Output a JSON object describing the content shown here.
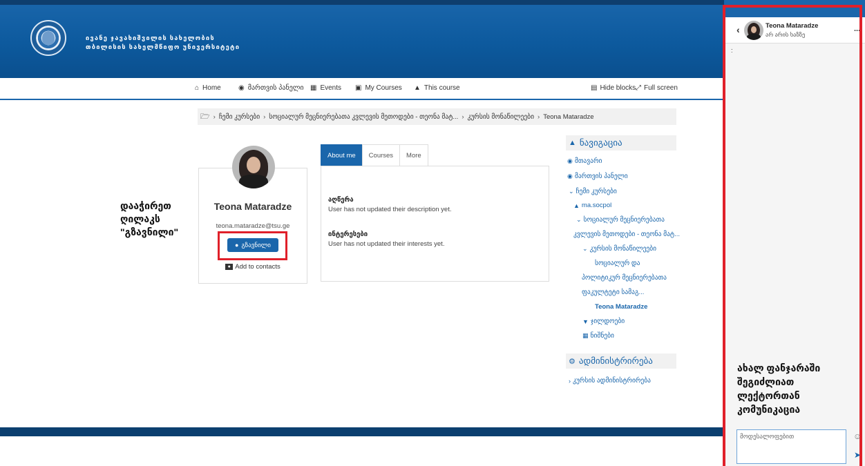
{
  "header": {
    "university_line1": "ივანე ჯავახიშვილის სახელობის",
    "university_line2": "თბილისის სახელმწიფო უნივერსიტეტი"
  },
  "nav": {
    "home": "Home",
    "dashboard": "მართვის პანელი",
    "events": "Events",
    "my_courses": "My Courses",
    "this_course": "This course",
    "hide_blocks": "Hide blocks",
    "full_screen": "Full screen"
  },
  "breadcrumb": {
    "items": [
      "ჩემი კურსები",
      "სოციალურ მეცნიერებათა კვლევის მეთოდები - თეონა მატ...",
      "კურსის მონაწილეები",
      "Teona Mataradze"
    ]
  },
  "annotations": {
    "left": "დააჭირეთ ღილაკს \"გზავნილი\"",
    "right": "ახალ ფანჯარაში შეგიძლიათ ლექტორთან კომუნიკაცია"
  },
  "profile": {
    "name": "Teona Mataradze",
    "email": "teona.mataradze@tsu.ge",
    "message_button": "გზავნილი",
    "add_contacts": "Add to contacts"
  },
  "tabs": {
    "items": [
      "About me",
      "Courses",
      "More"
    ],
    "active": "About me"
  },
  "about": {
    "description_label": "აღწერა",
    "description_value": "User has not updated their description yet.",
    "interests_label": "ინტერესები",
    "interests_value": "User has not updated their interests yet."
  },
  "navigation_block": {
    "title": "ნავიგაცია",
    "items": {
      "home": "მთავარი",
      "dashboard": "მართვის პანელი",
      "my_courses": "ჩემი კურსები",
      "course_short": "ma.socpol",
      "course_full_1": "სოციალურ მეცნიერებათა",
      "course_full_2": "კვლევის მეთოდები - თეონა მატ...",
      "participants": "კურსის მონაწილეები",
      "faculty_1": "სოციალურ და",
      "faculty_2": "პოლიტიკურ მეცნიერებათა",
      "faculty_3": "ფაკულტეტი სამაგ...",
      "current_user": "Teona Mataradze",
      "badges": "ჯილდოები",
      "grades": "ნიშნები"
    }
  },
  "administration_block": {
    "title": "ადმინისტრირება",
    "course_admin": "კურსის ადმინისტრირება"
  },
  "drawer": {
    "name": "Teona Mataradze",
    "status": "არ არის ხაზზე",
    "more": "...",
    "input_placeholder": "მოდესალოფებით"
  },
  "colors": {
    "primary": "#1a66ab",
    "annotation_red": "#e0202a",
    "footer": "#0b3f6f"
  }
}
